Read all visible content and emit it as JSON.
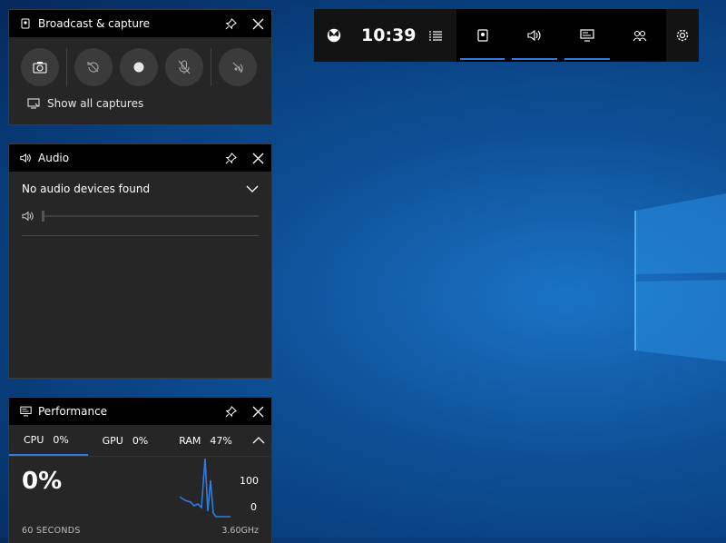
{
  "gamebar": {
    "time": "10:39",
    "tools": [
      "capture-widget",
      "audio-widget",
      "performance-widget",
      "social-widget"
    ]
  },
  "capture": {
    "title": "Broadcast & capture",
    "show_all_label": "Show all captures"
  },
  "audio": {
    "title": "Audio",
    "device_label": "No audio devices found",
    "volume_fraction": 0
  },
  "performance": {
    "title": "Performance",
    "tabs": [
      {
        "label": "CPU",
        "value": "0%"
      },
      {
        "label": "GPU",
        "value": "0%"
      },
      {
        "label": "RAM",
        "value": "47%"
      }
    ],
    "big_value": "0%",
    "axis_max": "100",
    "axis_min": "0",
    "time_window": "60 SECONDS",
    "frequency": "3.60GHz",
    "graph_color": "#2d7de0"
  },
  "colors": {
    "accent": "#2d7de0",
    "widget_bg": "#262626",
    "header_bg": "#000000"
  }
}
